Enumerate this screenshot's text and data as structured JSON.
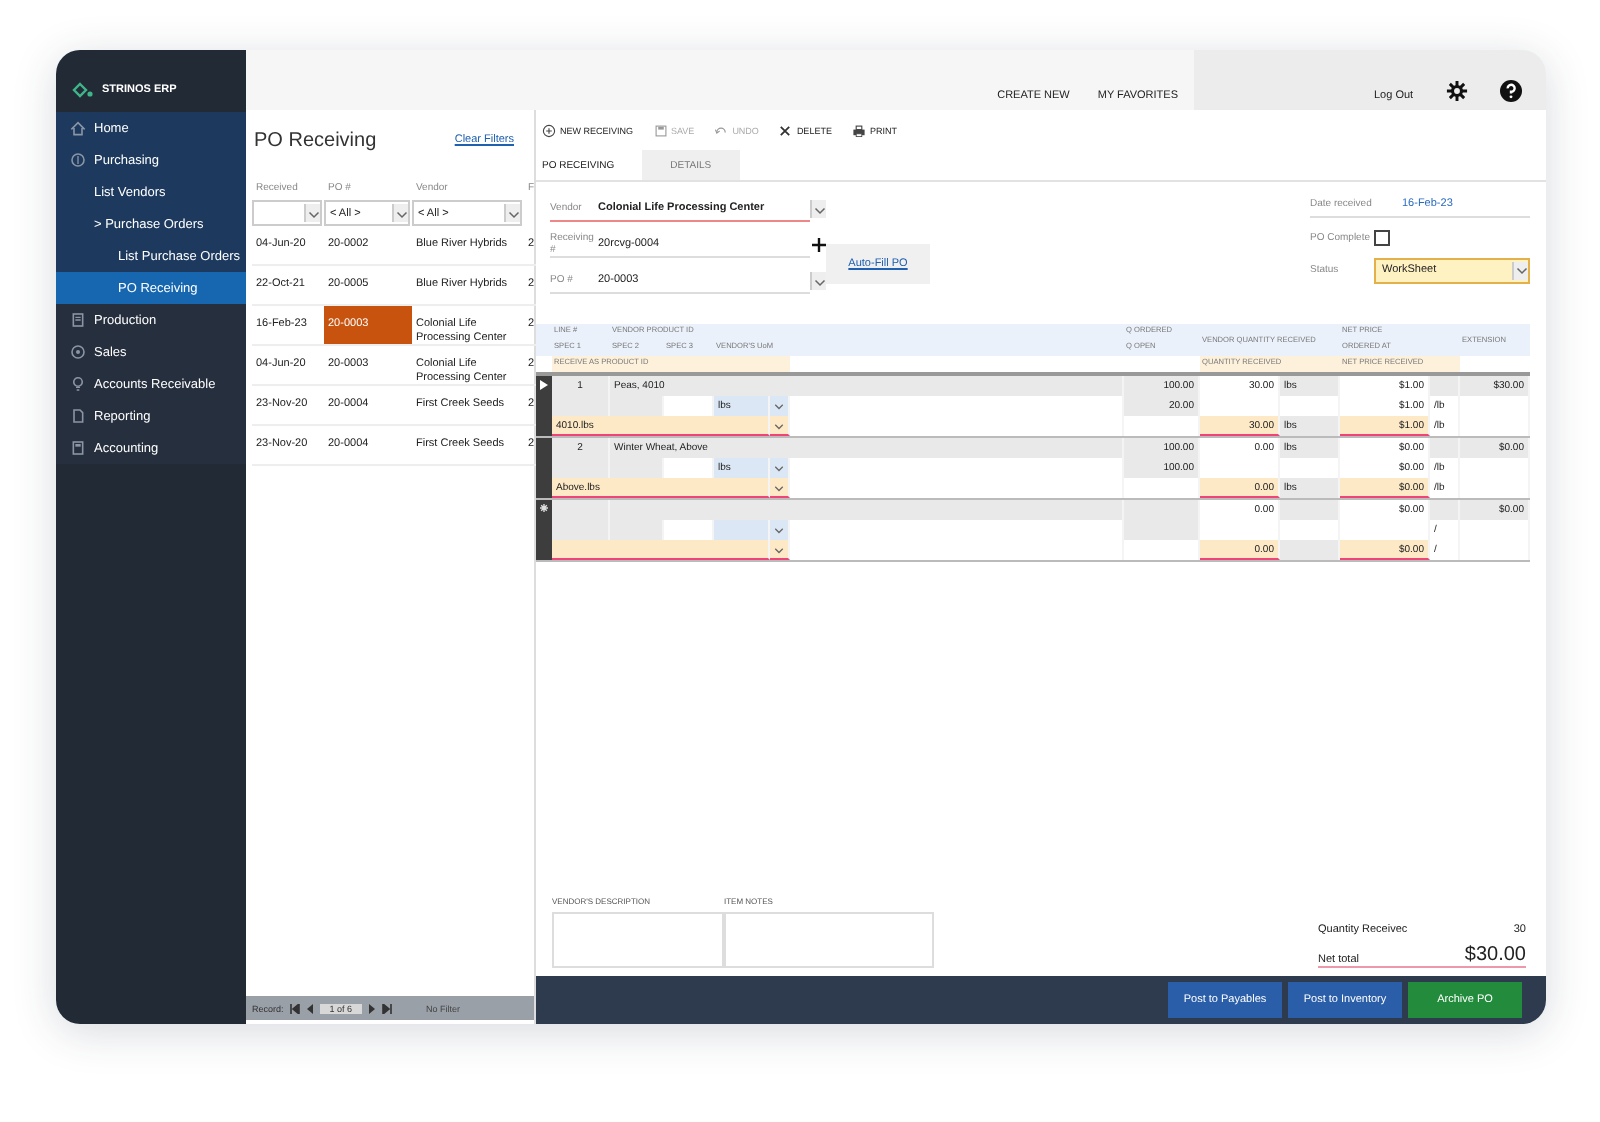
{
  "app": {
    "name": "STRINOS ERP"
  },
  "header": {
    "links": [
      "CREATE NEW",
      "MY FAVORITES"
    ],
    "logout": "Log Out"
  },
  "sidebar": {
    "sections": [
      {
        "open": true,
        "items": [
          {
            "label": "Home",
            "selected": false
          },
          {
            "label": "Purchasing",
            "selected": false,
            "children": [
              {
                "label": "List Vendors",
                "selected": false
              },
              {
                "label": "> Purchase Orders",
                "selected": false,
                "children": [
                  {
                    "label": "List Purchase Orders",
                    "selected": false
                  },
                  {
                    "label": "PO Receiving",
                    "selected": true
                  }
                ]
              }
            ]
          }
        ]
      },
      {
        "open": false,
        "items": [
          {
            "label": "Production",
            "selected": false
          },
          {
            "label": "Sales",
            "selected": false
          },
          {
            "label": "Accounts Receivable",
            "selected": false
          },
          {
            "label": "Reporting",
            "selected": false
          },
          {
            "label": "Accounting",
            "selected": false
          }
        ]
      }
    ]
  },
  "list": {
    "title": "PO Receiving",
    "clear_filters": "Clear Filters",
    "columns": [
      "Received",
      "PO #",
      "Vendor",
      "F"
    ],
    "filters": [
      {
        "kind": "blank"
      },
      {
        "kind": "choice",
        "value": "< All >"
      },
      {
        "kind": "choice",
        "value": "< All >"
      }
    ],
    "rows": [
      {
        "received": "04-Jun-20",
        "po": "20-0002",
        "vendor": "Blue River Hybrids",
        "column_4": "2",
        "selected": false
      },
      {
        "received": "22-Oct-21",
        "po": "20-0005",
        "vendor": "Blue River Hybrids",
        "column_4": "2",
        "selected": false
      },
      {
        "received": "16-Feb-23",
        "po": "20-0003",
        "vendor": "Colonial Life Processing Center",
        "column_4": "2",
        "selected": true
      },
      {
        "received": "04-Jun-20",
        "po": "20-0003",
        "vendor": "Colonial Life Processing Center",
        "column_4": "2",
        "selected": false
      },
      {
        "received": "23-Nov-20",
        "po": "20-0004",
        "vendor": "First Creek Seeds",
        "column_4": "2",
        "selected": false
      },
      {
        "received": "23-Nov-20",
        "po": "20-0004",
        "vendor": "First Creek Seeds",
        "column_4": "2",
        "selected": false
      }
    ],
    "record_nav": {
      "label": "Record:",
      "position": "1 of 6",
      "filter": "No Filter"
    }
  },
  "toolbar": [
    {
      "label": "NEW RECEIVING",
      "disabled": false
    },
    {
      "label": "SAVE",
      "disabled": true
    },
    {
      "label": "UNDO",
      "disabled": true
    },
    {
      "label": "DELETE",
      "disabled": false
    },
    {
      "label": "PRINT",
      "disabled": false
    }
  ],
  "tabs": [
    {
      "label": "PO RECEIVING",
      "selected": true
    },
    {
      "label": "DETAILS",
      "selected": false
    }
  ],
  "form": {
    "vendor": {
      "label": "Vendor",
      "value": "Colonial Life Processing Center"
    },
    "receiving": {
      "label": "Receiving #",
      "value": "20rcvg-0004"
    },
    "po": {
      "label": "PO #",
      "value": "20-0003"
    },
    "autofill": "Auto-Fill PO",
    "date_received": {
      "label": "Date received",
      "value": "16-Feb-23"
    },
    "po_complete": {
      "label": "PO Complete",
      "checked": false
    },
    "status": {
      "label": "Status",
      "value": "WorkSheet"
    }
  },
  "grid": {
    "headers": [
      "LINE #",
      "VENDOR PRODUCT ID",
      "Q ORDERED",
      "VENDOR QUANTITY RECEIVED",
      "NET PRICE",
      "EXTENSION",
      "SPEC 1",
      "SPEC 2",
      "SPEC 3",
      "VENDOR'S UoM",
      "Q OPEN",
      "ORDERED AT",
      "RECEIVE AS PRODUCT ID",
      "QUANTITY RECEIVED",
      "NET PRICE RECEIVED"
    ],
    "records": [
      {
        "current": true,
        "new": false,
        "line": "1",
        "product": "Peas, 4010",
        "q_ordered": "100.00",
        "vendor_qty": "30.00",
        "vendor_unit": "lbs",
        "net_price": "$1.00",
        "extension": "$30.00",
        "uom": "lbs",
        "q_open": "20.00",
        "ordered_at": "$1.00",
        "ordered_per": "/lb",
        "receive_as": "4010.lbs",
        "qty_received": "30.00",
        "received_unit": "lbs",
        "price_received": "$1.00",
        "received_per": "/lb"
      },
      {
        "current": false,
        "new": false,
        "line": "2",
        "product": "Winter Wheat, Above",
        "q_ordered": "100.00",
        "vendor_qty": "0.00",
        "vendor_unit": "lbs",
        "net_price": "$0.00",
        "extension": "$0.00",
        "uom": "lbs",
        "q_open": "100.00",
        "ordered_at": "$0.00",
        "ordered_per": "/lb",
        "receive_as": "Above.lbs",
        "qty_received": "0.00",
        "received_unit": "lbs",
        "price_received": "$0.00",
        "received_per": "/lb"
      },
      {
        "current": false,
        "new": true,
        "vendor_qty": "0.00",
        "net_price": "$0.00",
        "extension": "$0.00",
        "ordered_per": "/",
        "qty_received": "0.00",
        "price_received": "$0.00",
        "received_per": "/"
      }
    ]
  },
  "notes": {
    "vendor_description": "VENDOR'S DESCRIPTION",
    "item_notes": "ITEM NOTES"
  },
  "totals": {
    "quantity_label": "Quantity Receivec",
    "quantity": "30",
    "net_label": "Net total",
    "net": "$30.00"
  },
  "actions": [
    {
      "label": "Post to Payables",
      "kind": "primary"
    },
    {
      "label": "Post to Inventory",
      "kind": "primary"
    },
    {
      "label": "Archive PO",
      "kind": "success"
    }
  ]
}
